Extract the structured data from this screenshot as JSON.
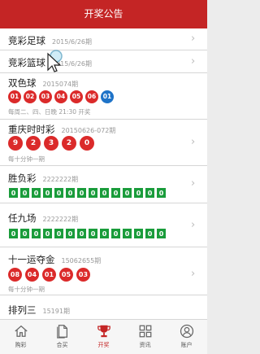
{
  "header": {
    "title": "开奖公告"
  },
  "lotteries": [
    {
      "name": "竞彩足球",
      "issue": "2015/6/26期"
    },
    {
      "name": "竞彩篮球",
      "issue": "2015/6/26期"
    },
    {
      "name": "双色球",
      "issue": "2015074期",
      "numbers": [
        "01",
        "02",
        "03",
        "04",
        "05",
        "06"
      ],
      "blue": [
        "01"
      ],
      "schedule": "每周二、四、日晚 21:30 开奖"
    },
    {
      "name": "重庆时时彩",
      "issue": "20150626-072期",
      "numbers": [
        "9",
        "2",
        "3",
        "2",
        "0"
      ],
      "schedule": "每十分钟一期"
    },
    {
      "name": "胜负彩",
      "issue": "2222222期",
      "digits": [
        "0",
        "0",
        "0",
        "0",
        "0",
        "0",
        "0",
        "0",
        "0",
        "0",
        "0",
        "0",
        "0",
        "0"
      ]
    },
    {
      "name": "任九场",
      "issue": "2222222期",
      "digits": [
        "0",
        "0",
        "0",
        "0",
        "0",
        "0",
        "0",
        "0",
        "0",
        "0",
        "0",
        "0",
        "0",
        "0"
      ]
    },
    {
      "name": "十一运夺金",
      "issue": "15062655期",
      "numbers": [
        "08",
        "04",
        "01",
        "05",
        "03"
      ],
      "schedule": "每十分钟一期"
    },
    {
      "name": "排列三",
      "issue": "15191期"
    }
  ],
  "tabbar": [
    {
      "label": "购彩",
      "icon": "home-icon"
    },
    {
      "label": "合买",
      "icon": "document-icon"
    },
    {
      "label": "开奖",
      "icon": "trophy-icon"
    },
    {
      "label": "资讯",
      "icon": "grid-icon"
    },
    {
      "label": "账户",
      "icon": "user-icon"
    }
  ],
  "colors": {
    "brand": "#c42525",
    "ball_red": "#db2a2a",
    "ball_blue": "#1e73c8",
    "digit_green": "#1a9c3b"
  }
}
